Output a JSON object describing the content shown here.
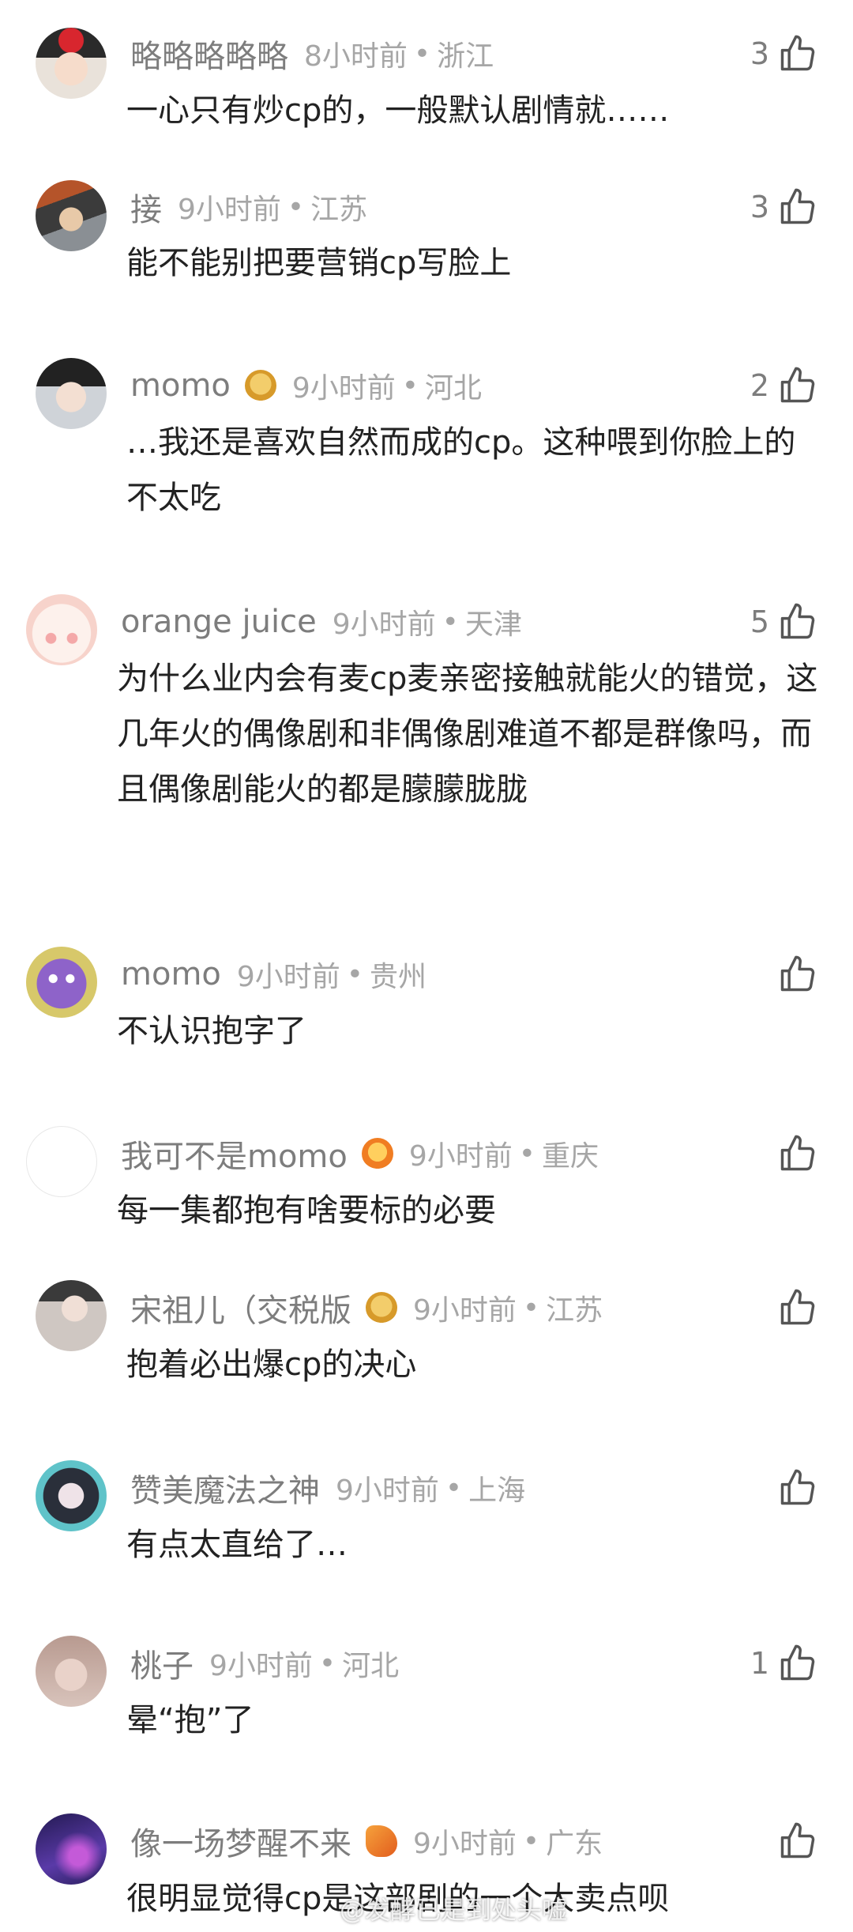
{
  "comments": [
    {
      "username": "略略略略略",
      "time": "8小时前",
      "location": "浙江",
      "likes": "3",
      "text": "一心只有炒cp的，一般默认剧情就……"
    },
    {
      "username": "接",
      "time": "9小时前",
      "location": "江苏",
      "likes": "3",
      "text": "能不能别把要营销cp写脸上"
    },
    {
      "username": "momo",
      "time": "9小时前",
      "location": "河北",
      "likes": "2",
      "text": "…我还是喜欢自然而成的cp。这种喂到你脸上的不太吃"
    },
    {
      "username": "orange juice",
      "time": "9小时前",
      "location": "天津",
      "likes": "5",
      "text": "为什么业内会有麦cp麦亲密接触就能火的错觉，这几年火的偶像剧和非偶像剧难道不都是群像吗，而且偶像剧能火的都是朦朦胧胧"
    },
    {
      "username": "momo",
      "time": "9小时前",
      "location": "贵州",
      "likes": "",
      "text": "不认识抱字了"
    },
    {
      "username": "我可不是momo",
      "time": "9小时前",
      "location": "重庆",
      "likes": "",
      "text": "每一集都抱有啥要标的必要"
    },
    {
      "username": "宋祖儿（交税版",
      "time": "9小时前",
      "location": "江苏",
      "likes": "",
      "text": "抱着必出爆cp的决心"
    },
    {
      "username": "赞美魔法之神",
      "time": "9小时前",
      "location": "上海",
      "likes": "",
      "text": "有点太直给了…"
    },
    {
      "username": "桃子",
      "time": "9小时前",
      "location": "河北",
      "likes": "1",
      "text": "晕“抱”了"
    },
    {
      "username": "像一场梦醒不来",
      "time": "9小时前",
      "location": "广东",
      "likes": "",
      "text": "很明显觉得cp是这部剧的一个大卖点呗"
    }
  ],
  "separator": "•",
  "icons": {
    "like": "thumbs-up-icon",
    "badge_lantern": "lantern-badge-icon",
    "badge_fish": "koi-fish-badge-icon"
  },
  "watermark": "@发酵已是到处头嘘",
  "colors": {
    "username": "#7d7d7d",
    "meta": "#a6a6a6",
    "text": "#222222",
    "background": "#ffffff"
  }
}
